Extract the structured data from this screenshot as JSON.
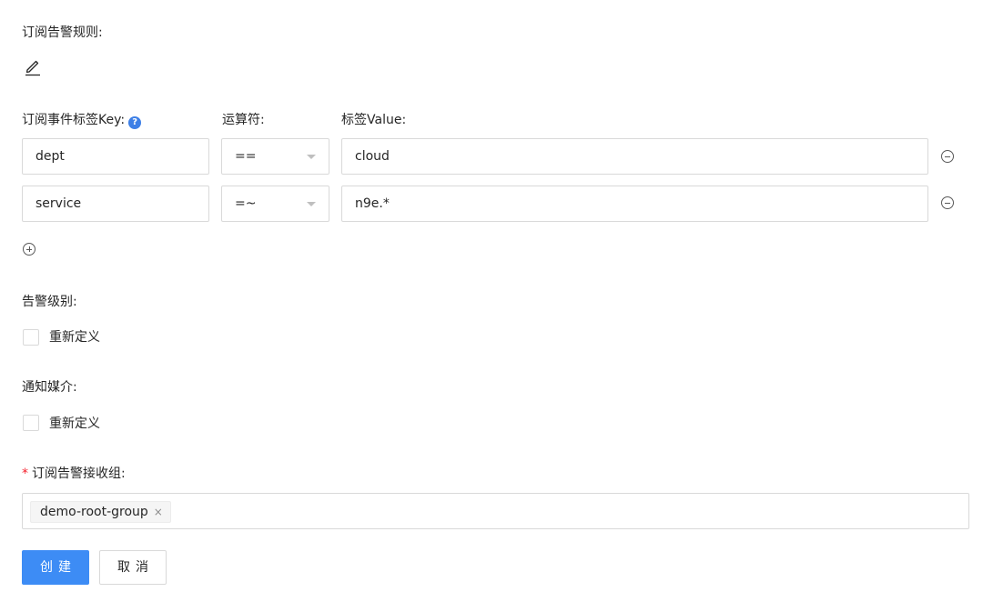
{
  "rule_section": {
    "label": "订阅告警规则:",
    "edit_icon": "edit-pencil-icon"
  },
  "tag_filters": {
    "key_header": "订阅事件标签Key:",
    "help_icon": "question-circle-icon",
    "help_glyph": "?",
    "operator_header": "运算符:",
    "value_header": "标签Value:",
    "rows": [
      {
        "key": "dept",
        "operator": "==",
        "value": "cloud"
      },
      {
        "key": "service",
        "operator": "=~",
        "value": "n9e.*"
      }
    ],
    "remove_icon": "minus-circle-icon",
    "add_icon": "plus-circle-icon"
  },
  "severity": {
    "label": "告警级别:",
    "checkbox_label": "重新定义"
  },
  "notify_channel": {
    "label": "通知媒介:",
    "checkbox_label": "重新定义"
  },
  "receiver_groups": {
    "required_mark": "*",
    "label": "订阅告警接收组:",
    "tags": [
      "demo-root-group"
    ],
    "tag_close_glyph": "×"
  },
  "actions": {
    "create_label": "创建",
    "cancel_label": "取消",
    "primary_color": "#3d8cf5"
  }
}
